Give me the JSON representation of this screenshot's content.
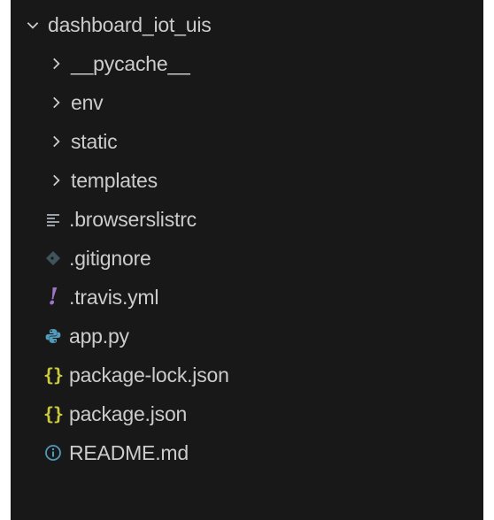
{
  "explorer": {
    "root": {
      "label": "dashboard_iot_uis",
      "icon": "chevron-down-icon",
      "expanded": true
    },
    "folders": [
      {
        "label": "__pycache__",
        "icon": "chevron-right-icon"
      },
      {
        "label": "env",
        "icon": "chevron-right-icon"
      },
      {
        "label": "static",
        "icon": "chevron-right-icon"
      },
      {
        "label": "templates",
        "icon": "chevron-right-icon"
      }
    ],
    "files": [
      {
        "label": ".browserslistrc",
        "icon": "text-lines-icon",
        "color": "#9aa0a6"
      },
      {
        "label": ".gitignore",
        "icon": "git-diamond-icon",
        "color": "#41535b"
      },
      {
        "label": ".travis.yml",
        "icon": "exclamation-icon",
        "color": "#a074c4"
      },
      {
        "label": "app.py",
        "icon": "python-icon",
        "color": "#519aba"
      },
      {
        "label": "package-lock.json",
        "icon": "json-braces-icon",
        "color": "#cbcb41"
      },
      {
        "label": "package.json",
        "icon": "json-braces-icon",
        "color": "#cbcb41"
      },
      {
        "label": "README.md",
        "icon": "info-circle-icon",
        "color": "#519aba"
      }
    ]
  },
  "colors": {
    "background": "#181818",
    "text": "#cccccc"
  },
  "glyphs": {
    "braces": "{}",
    "exclamation": "!"
  }
}
